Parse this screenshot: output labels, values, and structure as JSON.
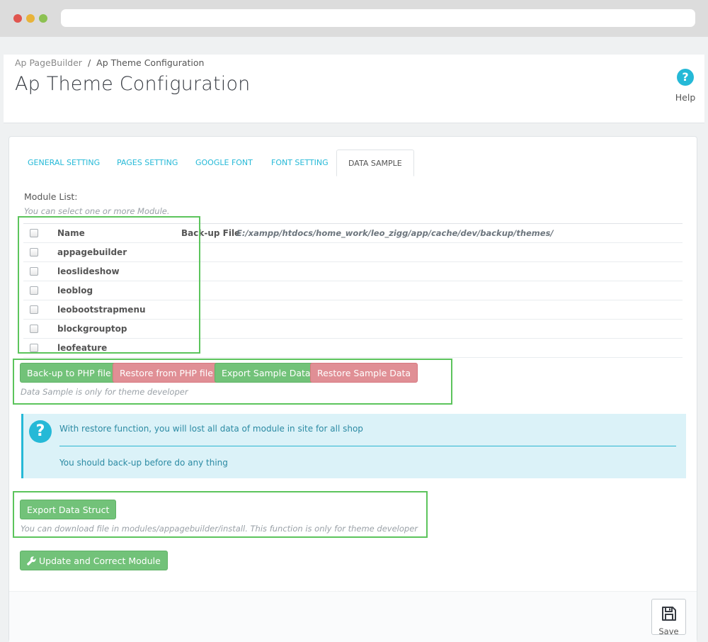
{
  "breadcrumb": {
    "parent": "Ap PageBuilder",
    "separator": "/",
    "current": "Ap Theme Configuration"
  },
  "page": {
    "title": "Ap Theme Configuration"
  },
  "toolbar": {
    "help_label": "Help",
    "help_icon": "question-circle-icon"
  },
  "tabs": [
    {
      "label": "GENERAL SETTING",
      "active": false
    },
    {
      "label": "PAGES SETTING",
      "active": false
    },
    {
      "label": "GOOGLE FONT",
      "active": false
    },
    {
      "label": "FONT SETTING",
      "active": false
    },
    {
      "label": "DATA SAMPLE",
      "active": true
    }
  ],
  "module_list": {
    "label": "Module List:",
    "hint": "You can select one or more Module.",
    "header_name": "Name",
    "backup_label": "Back-up File",
    "backup_path": "E:/xampp/htdocs/home_work/leo_zigg/app/cache/dev/backup/themes/",
    "modules": [
      {
        "name": "appagebuilder"
      },
      {
        "name": "leoslideshow"
      },
      {
        "name": "leoblog"
      },
      {
        "name": "leobootstrapmenu"
      },
      {
        "name": "blockgrouptop"
      },
      {
        "name": "leofeature"
      }
    ]
  },
  "actions": {
    "backup_php": "Back-up to PHP file",
    "restore_php": "Restore from PHP file",
    "export_sample": "Export Sample Data",
    "restore_sample": "Restore Sample Data",
    "hint": "Data Sample is only for theme developer"
  },
  "alert": {
    "line1": "With restore function, you will lost all data of module in site for all shop",
    "line2": "You should back-up before do any thing"
  },
  "export_struct": {
    "button": "Export Data Struct",
    "hint": "You can download file in modules/appagebuilder/install. This function is only for theme developer"
  },
  "update_module": {
    "button": "Update and Correct Module",
    "icon": "wrench-icon"
  },
  "footer": {
    "save_label": "Save",
    "save_icon": "floppy-disk-icon"
  },
  "colors": {
    "accent": "#25b9d7",
    "success": "#72c279",
    "danger": "#e08f95",
    "annotation": "#5cc45c"
  }
}
